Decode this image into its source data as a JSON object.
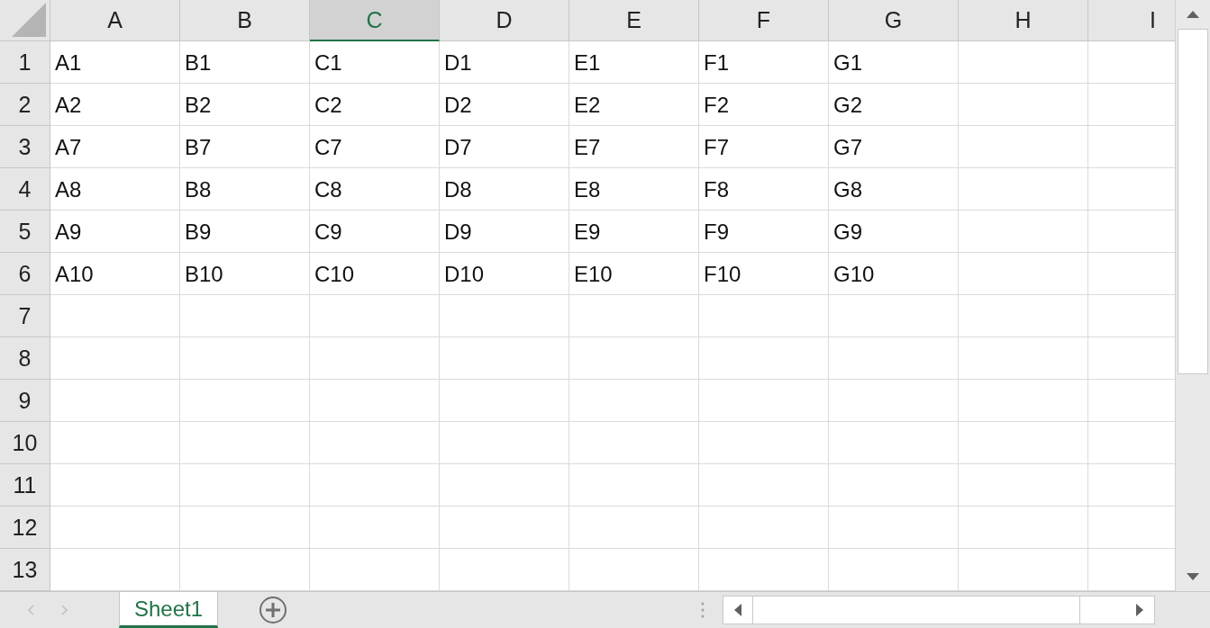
{
  "columns": [
    {
      "label": "A",
      "selected": false
    },
    {
      "label": "B",
      "selected": false
    },
    {
      "label": "C",
      "selected": true
    },
    {
      "label": "D",
      "selected": false
    },
    {
      "label": "E",
      "selected": false
    },
    {
      "label": "F",
      "selected": false
    },
    {
      "label": "G",
      "selected": false
    },
    {
      "label": "H",
      "selected": false
    },
    {
      "label": "I",
      "selected": false
    }
  ],
  "rows": [
    {
      "header": "1",
      "cells": [
        "A1",
        "B1",
        "C1",
        "D1",
        "E1",
        "F1",
        "G1"
      ]
    },
    {
      "header": "2",
      "cells": [
        "A2",
        "B2",
        "C2",
        "D2",
        "E2",
        "F2",
        "G2"
      ]
    },
    {
      "header": "3",
      "cells": [
        "A7",
        "B7",
        "C7",
        "D7",
        "E7",
        "F7",
        "G7"
      ]
    },
    {
      "header": "4",
      "cells": [
        "A8",
        "B8",
        "C8",
        "D8",
        "E8",
        "F8",
        "G8"
      ]
    },
    {
      "header": "5",
      "cells": [
        "A9",
        "B9",
        "C9",
        "D9",
        "E9",
        "F9",
        "G9"
      ]
    },
    {
      "header": "6",
      "cells": [
        "A10",
        "B10",
        "C10",
        "D10",
        "E10",
        "F10",
        "G10"
      ]
    },
    {
      "header": "7"
    },
    {
      "header": "8"
    },
    {
      "header": "9"
    },
    {
      "header": "10"
    },
    {
      "header": "11"
    },
    {
      "header": "12"
    },
    {
      "header": "13"
    }
  ],
  "sheet_tabs": [
    {
      "label": "Sheet1",
      "selected": true
    }
  ]
}
